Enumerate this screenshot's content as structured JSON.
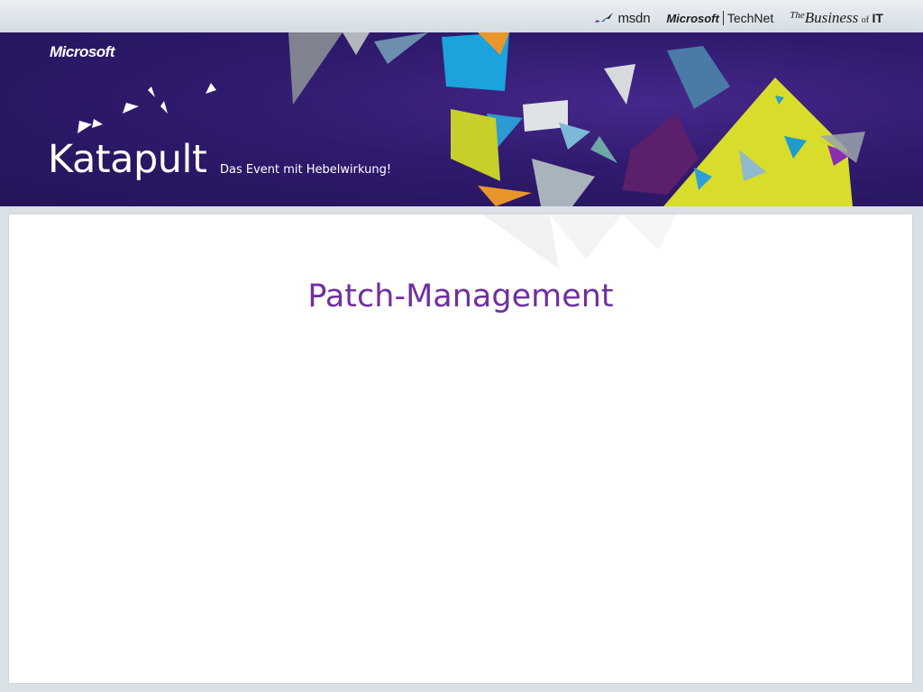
{
  "header": {
    "sponsors": {
      "msdn": "msdn",
      "microsoft": "Microsoft",
      "technet": "TechNet",
      "business_the": "The",
      "business_word": "Business",
      "business_of": "of",
      "business_it": "IT"
    }
  },
  "banner": {
    "brand": "Microsoft",
    "event_name": "Katapult",
    "tagline": "Das Event mit Hebelwirkung!"
  },
  "slide": {
    "title": "Patch-Management"
  },
  "colors": {
    "banner_purple": "#301a6e",
    "title_purple": "#7030a0",
    "accent_yellow": "#d8dc2a",
    "accent_blue": "#1ba3dd"
  }
}
